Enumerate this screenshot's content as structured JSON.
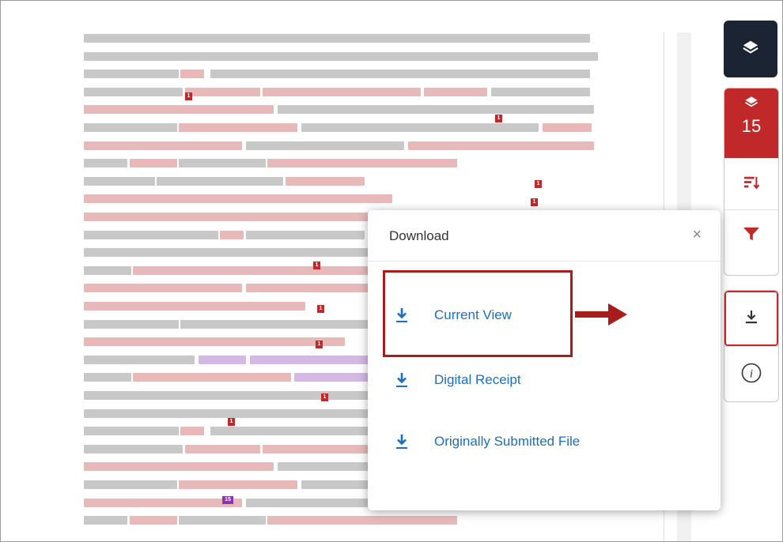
{
  "popup": {
    "title": "Download",
    "close_symbol": "×",
    "items": [
      {
        "label": "Current View",
        "icon": "download-icon"
      },
      {
        "label": "Digital Receipt",
        "icon": "download-icon"
      },
      {
        "label": "Originally Submitted File",
        "icon": "download-icon"
      }
    ]
  },
  "sidebar": {
    "match_count": "15",
    "layers_icon": "layers-icon",
    "sort_icon": "sort-icon",
    "filter_icon": "filter-icon",
    "download_icon": "download-icon",
    "info_icon": "info-icon"
  },
  "document": {
    "markers": [
      "1",
      "1",
      "1",
      "1",
      "1",
      "1",
      "1",
      "1",
      "1",
      "15"
    ]
  },
  "colors": {
    "accent": "#c0282a",
    "dark": "#1c2333",
    "link": "#1a6fbf",
    "highlight": "#d98b8b",
    "purple": "#8a35a8"
  }
}
